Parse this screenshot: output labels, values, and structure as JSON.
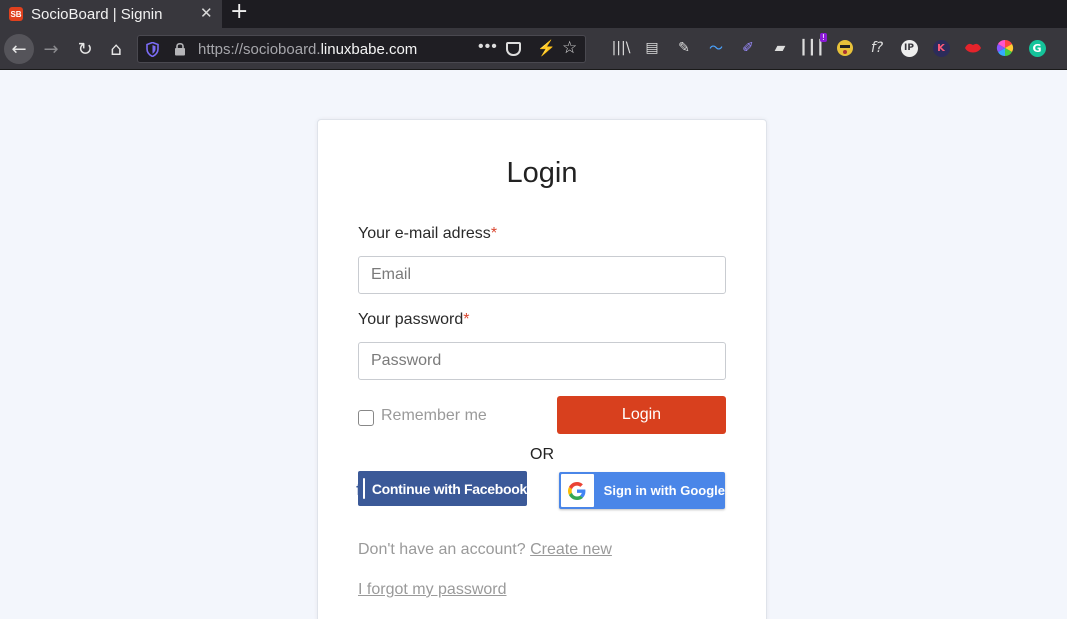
{
  "browser": {
    "tab": {
      "favicon_text": "SB",
      "title": "SocioBoard | Signin",
      "close": "✕"
    },
    "new_tab": "+",
    "nav": {
      "back": "←",
      "forward": "→",
      "reload": "↻",
      "home": "⌂"
    },
    "url": {
      "scheme_prefix": "https://socioboard.",
      "host": "linuxbabe.com"
    },
    "url_more": "•••",
    "extensions": {
      "library": "|||\\",
      "reader": "▤",
      "pen": "✎",
      "pencil2": "✐",
      "eraser": "▰",
      "notification_badge": "!",
      "formula": "f?",
      "ip": "IP",
      "k": "K",
      "g": "G"
    }
  },
  "login": {
    "title": "Login",
    "email_label": "Your e-mail adress",
    "email_placeholder": "Email",
    "password_label": "Your password",
    "password_placeholder": "Password",
    "required_mark": "*",
    "remember_label": "Remember me",
    "login_button": "Login",
    "or": "OR",
    "facebook_button": "Continue with Facebook",
    "facebook_icon": "f",
    "google_button": "Sign in with Google",
    "signup_prompt": "Don't have an account?",
    "signup_link": "Create new",
    "forgot_link": "I forgot my password"
  },
  "colors": {
    "page_bg": "#f3f6fc",
    "login_button": "#d8401e",
    "facebook": "#3b5998",
    "google": "#4a86e8",
    "required": "#d9452e"
  }
}
